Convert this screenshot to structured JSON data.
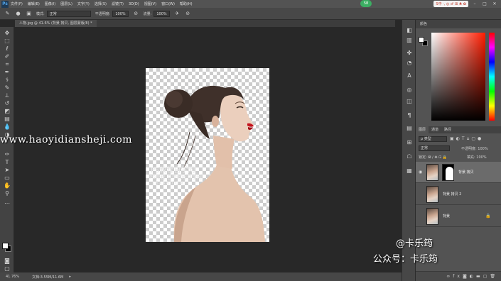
{
  "app": {
    "logo": "Ps",
    "avatar_label": "58"
  },
  "menu": [
    "文件(F)",
    "编辑(E)",
    "图像(I)",
    "图层(L)",
    "文字(Y)",
    "选择(S)",
    "滤镜(T)",
    "3D(D)",
    "视图(V)",
    "窗口(W)",
    "帮助(H)"
  ],
  "tray": {
    "label": "S中 ·, ◎ ♂ ⊞ ♣ ✿"
  },
  "options": {
    "mode_label": "模式:",
    "mode_value": "正常",
    "opacity_label": "不透明度:",
    "opacity_value": "100%",
    "flow_label": "流量:",
    "flow_value": "100%"
  },
  "document": {
    "tab_title": "人物.jpg @ 41.6% (背景 拷贝, 图层蒙版/8) *"
  },
  "status": {
    "zoom": "41.76%",
    "doc_info": "文档:3.55M/11.6M"
  },
  "panels": {
    "color_title": "颜色",
    "layers_tabs": [
      "图层",
      "通道",
      "路径"
    ],
    "filter_kind": "ρ 类型",
    "blend_mode": "正常",
    "opacity_label": "不透明度: 100%",
    "lock_label": "锁定: ⊠ ∕ ✥ ⊡ 🔒",
    "fill_label": "填充: 100%"
  },
  "layers": [
    {
      "name": "背景 拷贝",
      "has_mask": true,
      "selected": true
    },
    {
      "name": "背景 拷贝 2",
      "has_mask": false,
      "selected": false
    },
    {
      "name": "背景",
      "has_mask": false,
      "selected": false,
      "locked": true
    }
  ],
  "watermarks": {
    "site": "www.haoyidiansheji.com",
    "ps_title": "PS教程自学网",
    "ps_sub": "PS教程 自学教程自学网",
    "ps_url": "16XX8.COM",
    "author": "@卡乐筠",
    "account": "公众号：卡乐筠"
  }
}
